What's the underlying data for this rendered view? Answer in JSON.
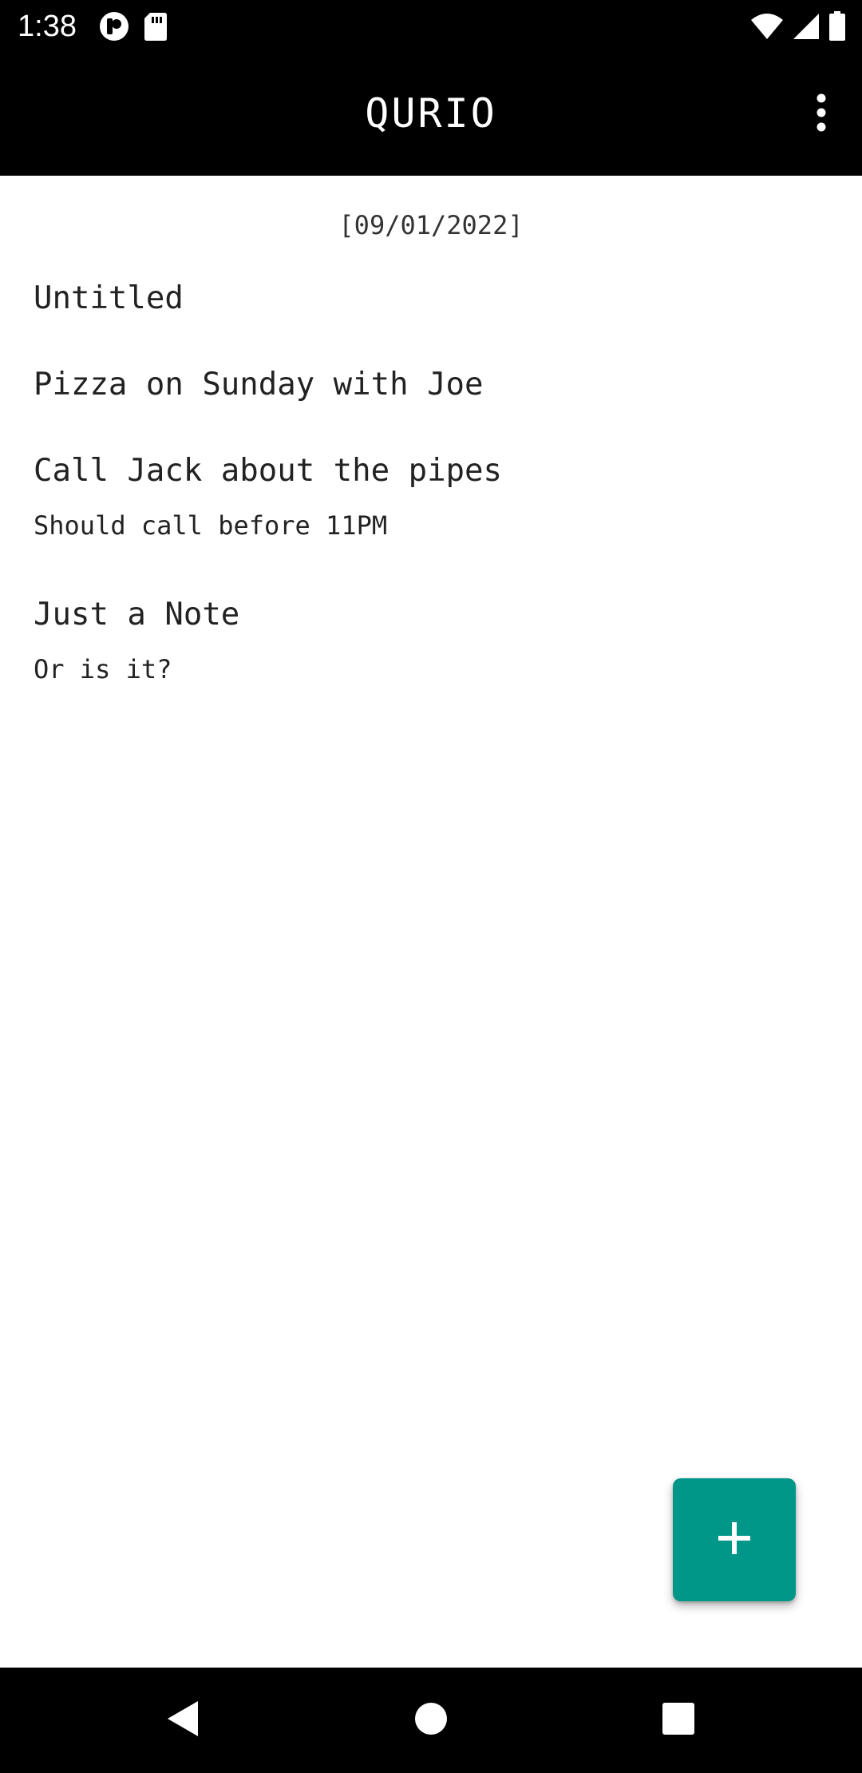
{
  "status_bar": {
    "time": "1:38",
    "left_icons": [
      "app-notification-icon",
      "sd-card-icon"
    ],
    "right_icons": [
      "wifi-icon",
      "cell-signal-icon",
      "battery-icon"
    ]
  },
  "app_bar": {
    "title": "QURIO",
    "overflow_icon": "more-vert-icon"
  },
  "notes_list": {
    "date_header": "[09/01/2022]",
    "notes": [
      {
        "title": "Untitled",
        "body": ""
      },
      {
        "title": "Pizza on Sunday with Joe",
        "body": ""
      },
      {
        "title": "Call Jack about the pipes",
        "body": "Should call before 11PM"
      },
      {
        "title": "Just a Note",
        "body": "Or is it?"
      }
    ]
  },
  "fab": {
    "icon": "plus-icon",
    "color": "#009688"
  },
  "nav_bar": {
    "buttons": [
      "back-icon",
      "home-icon",
      "recents-icon"
    ]
  }
}
